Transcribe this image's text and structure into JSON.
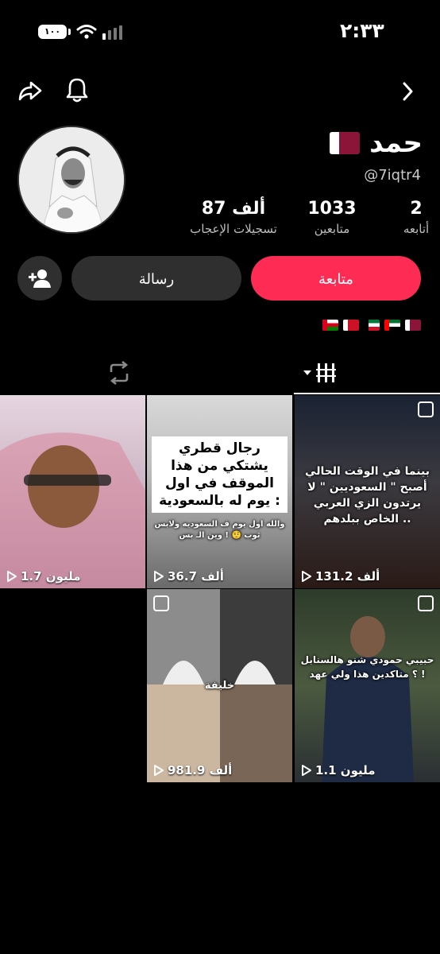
{
  "status_bar": {
    "time": "٢:٣٣",
    "battery": "١٠٠"
  },
  "profile": {
    "name": "حمد",
    "handle": "@7iqtr4",
    "stats": [
      {
        "value": "2",
        "label": "أتابعه"
      },
      {
        "value": "1033",
        "label": "متابعين"
      },
      {
        "value": "87 ألف",
        "label": "تسجيلات الإعجاب"
      }
    ],
    "follow_label": "متابعة",
    "message_label": "رسالة",
    "bio_flags": [
      "qatar",
      "uae",
      "kuwait",
      "bahrain",
      "oman"
    ]
  },
  "videos": [
    {
      "count": "131.2 ألف",
      "overlay": "بينما في الوقت الحالي أصبح \" السعوديين \" لا يرتدون الزي العربي الخاص ببلدهم .."
    },
    {
      "count": "36.7 ألف",
      "caption": "رجال قطري يشتكي من هذا الموقف في اول يوم له بالسعودية :",
      "sub": "والله اول يوم ف السعوديه ولابس ثوب 🤨 ! وين الـ بس"
    },
    {
      "count": "1.7 مليون"
    },
    {
      "count": "1.1 مليون",
      "overlay": "حبيبي حمودي شنو هالسنابل ؟ متاكدين هذا ولي عهد !"
    },
    {
      "count": "981.9 ألف",
      "overlay": "خليفة"
    }
  ],
  "colors": {
    "accent": "#fe2c55",
    "background": "#000000",
    "secondary_button": "#2f2f2f"
  }
}
